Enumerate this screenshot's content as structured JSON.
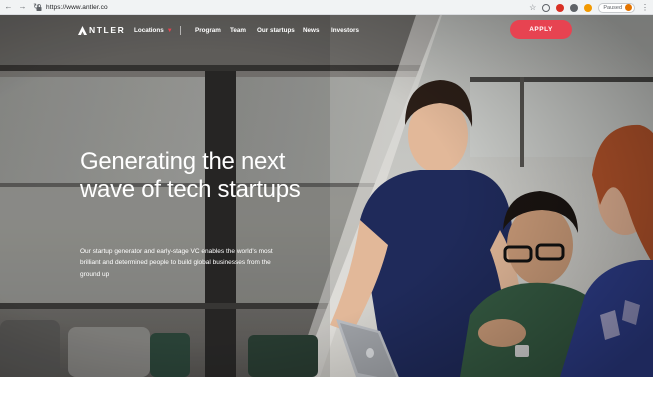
{
  "browser": {
    "url": "https://www.antler.co",
    "profile_status": "Paused",
    "icons": [
      "back-icon",
      "forward-icon",
      "reload-icon",
      "lock-icon",
      "star-icon",
      "extension-icon",
      "menu-icon"
    ]
  },
  "site": {
    "logo_text": "NTLER",
    "nav": {
      "locations": "Locations",
      "program": "Program",
      "team": "Team",
      "startups": "Our startups",
      "news": "News",
      "investors": "Investors"
    },
    "apply_label": "APPLY",
    "headline": "Generating the next wave of tech startups",
    "subtext": "Our startup generator and early-stage VC enables the world's most brilliant and determined people to build global businesses from the ground up"
  },
  "colors": {
    "accent": "#e74351",
    "text_on_dark": "#ffffff"
  }
}
